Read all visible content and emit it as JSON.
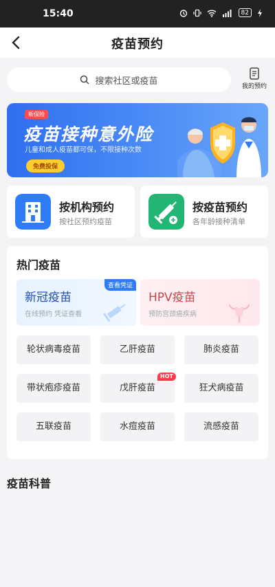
{
  "status_bar": {
    "time": "15:40",
    "battery": "82"
  },
  "nav": {
    "title": "疫苗预约"
  },
  "search": {
    "placeholder": "搜索社区或疫苗",
    "my_appointments": "我的预约"
  },
  "banner": {
    "tag": "新保险",
    "title": "疫苗接种意外险",
    "subtitle": "儿童和成人疫苗都可保，不限接种次数",
    "button": "免费投保"
  },
  "entries": [
    {
      "title": "按机构预约",
      "subtitle": "按社区预约疫苗",
      "color": "#2e7cf6"
    },
    {
      "title": "按疫苗预约",
      "subtitle": "各年龄接种清单",
      "color": "#22b573"
    }
  ],
  "hot": {
    "title": "热门疫苗",
    "featured": [
      {
        "title": "新冠疫苗",
        "subtitle": "在线预约 凭证查看",
        "tag": "查看凭证"
      },
      {
        "title": "HPV疫苗",
        "subtitle": "预防宫颈癌疾病"
      }
    ],
    "grid": [
      {
        "label": "轮状病毒疫苗"
      },
      {
        "label": "乙肝疫苗"
      },
      {
        "label": "肺炎疫苗"
      },
      {
        "label": "带状疱疹疫苗"
      },
      {
        "label": "戊肝疫苗",
        "badge": "HOT"
      },
      {
        "label": "狂犬病疫苗"
      },
      {
        "label": "五联疫苗"
      },
      {
        "label": "水痘疫苗"
      },
      {
        "label": "流感疫苗"
      }
    ]
  },
  "science": {
    "title": "疫苗科普"
  },
  "colors": {
    "primary": "#2e7cf6",
    "accent_red": "#ff3b4a",
    "banner_button": "#ffcd2e"
  }
}
